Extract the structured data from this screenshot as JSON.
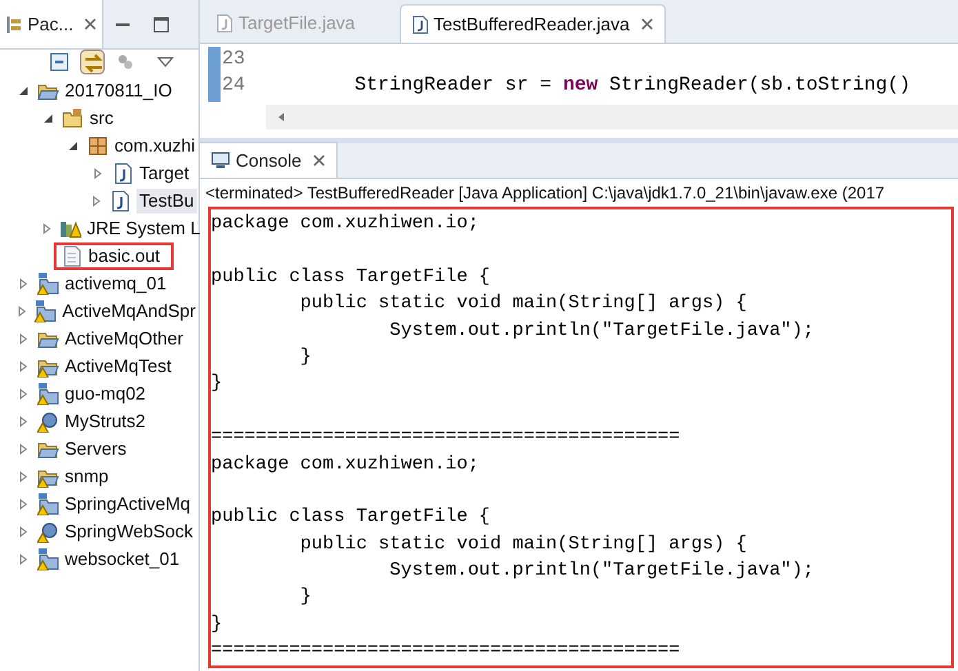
{
  "explorer": {
    "title": "Pac...",
    "tree": [
      {
        "label": "20170811_IO",
        "kind": "project",
        "expanded": true,
        "children": [
          {
            "label": "src",
            "kind": "srcfolder",
            "expanded": true,
            "children": [
              {
                "label": "com.xuzhi",
                "kind": "package",
                "expanded": true,
                "children": [
                  {
                    "label": "Target",
                    "kind": "java",
                    "expanded": false
                  },
                  {
                    "label": "TestBu",
                    "kind": "java",
                    "expanded": false,
                    "selected": true
                  }
                ]
              }
            ]
          },
          {
            "label": "JRE System L",
            "kind": "library",
            "expanded": false
          },
          {
            "label": "basic.out",
            "kind": "file",
            "highlighted": true
          }
        ]
      },
      {
        "label": "activemq_01",
        "kind": "mavenwarn",
        "expanded": false
      },
      {
        "label": "ActiveMqAndSpr",
        "kind": "mavenwarn",
        "expanded": false
      },
      {
        "label": "ActiveMqOther",
        "kind": "project",
        "expanded": false
      },
      {
        "label": "ActiveMqTest",
        "kind": "projectwarn",
        "expanded": false
      },
      {
        "label": "guo-mq02",
        "kind": "mavenwarn",
        "expanded": false
      },
      {
        "label": "MyStruts2",
        "kind": "webwarn",
        "expanded": false
      },
      {
        "label": "Servers",
        "kind": "project",
        "expanded": false
      },
      {
        "label": "snmp",
        "kind": "projectwarn",
        "expanded": false
      },
      {
        "label": "SpringActiveMq",
        "kind": "mavenwarn",
        "expanded": false
      },
      {
        "label": "SpringWebSock",
        "kind": "webwarn",
        "expanded": false
      },
      {
        "label": "websocket_01",
        "kind": "mavenwarn",
        "expanded": false
      }
    ]
  },
  "editor": {
    "tabs": [
      {
        "label": "TargetFile.java",
        "selected": false
      },
      {
        "label": "TestBufferedReader.java",
        "selected": true
      }
    ],
    "lines": [
      {
        "number": "23"
      },
      {
        "number": "24",
        "code": "        StringReader sr = **new** StringReader(sb.toString()"
      }
    ]
  },
  "console": {
    "title": "Console",
    "status": "<terminated> TestBufferedReader [Java Application] C:\\java\\jdk1.7.0_21\\bin\\javaw.exe (2017",
    "highlighted": true,
    "output": [
      {
        "kind": "text",
        "text": "package com.xuzhiwen.io;"
      },
      {
        "kind": "blank"
      },
      {
        "kind": "text",
        "text": "public class TargetFile {"
      },
      {
        "kind": "text",
        "text": "        public static void main(String[] args) {"
      },
      {
        "kind": "text",
        "text": "                System.out.println(\"TargetFile.java\");"
      },
      {
        "kind": "text",
        "text": "        }"
      },
      {
        "kind": "text",
        "text": "}"
      },
      {
        "kind": "blank"
      },
      {
        "kind": "text",
        "text": "=========================================="
      },
      {
        "kind": "text",
        "text": "package com.xuzhiwen.io;"
      },
      {
        "kind": "blank"
      },
      {
        "kind": "text",
        "text": "public class TargetFile {"
      },
      {
        "kind": "text",
        "text": "        public static void main(String[] args) {"
      },
      {
        "kind": "text",
        "text": "                System.out.println(\"TargetFile.java\");"
      },
      {
        "kind": "text",
        "text": "        }"
      },
      {
        "kind": "text",
        "text": "}"
      },
      {
        "kind": "text",
        "text": "=========================================="
      }
    ]
  }
}
